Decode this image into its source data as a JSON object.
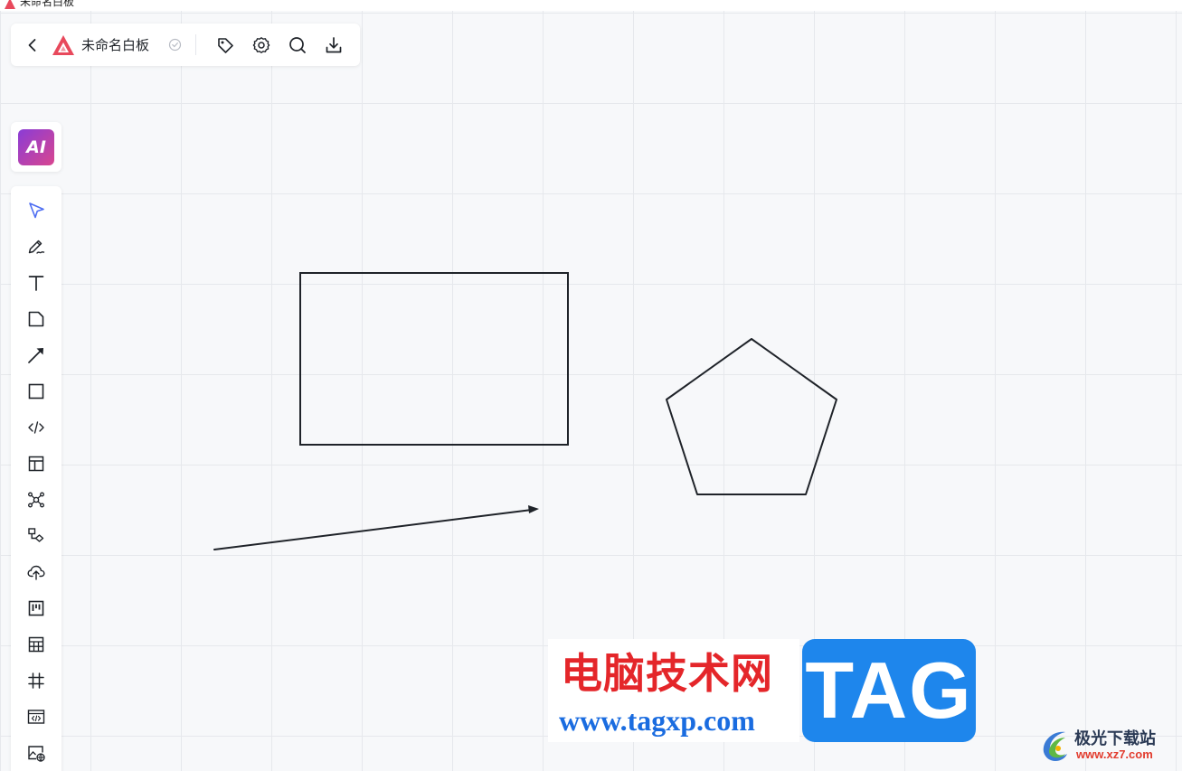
{
  "window": {
    "title": "未命名白板"
  },
  "topbar": {
    "board_title": "未命名白板",
    "buttons": [
      "back",
      "tag",
      "settings",
      "search",
      "download"
    ]
  },
  "ai": {
    "label": "AI"
  },
  "toolbar": {
    "tools": [
      "select",
      "pen",
      "text",
      "sticky-note",
      "arrow",
      "rectangle",
      "code-block",
      "layout-template",
      "mind-map",
      "flowchart",
      "upload",
      "kanban",
      "table",
      "frame",
      "embed",
      "web-image"
    ],
    "active": "select"
  },
  "canvas": {
    "shapes": [
      "rectangle",
      "pentagon",
      "arrow"
    ]
  },
  "watermarks": {
    "site_name": "电脑技术网",
    "site_url": "www.tagxp.com",
    "tag": "TAG",
    "brand2_name": "极光下载站",
    "brand2_url": "www.xz7.com"
  },
  "colors": {
    "accent": "#4e6ef2",
    "stroke": "#1f2329",
    "logo": "#e8495c",
    "watermark_red": "#e4262a",
    "watermark_blue": "#1e86ec"
  }
}
